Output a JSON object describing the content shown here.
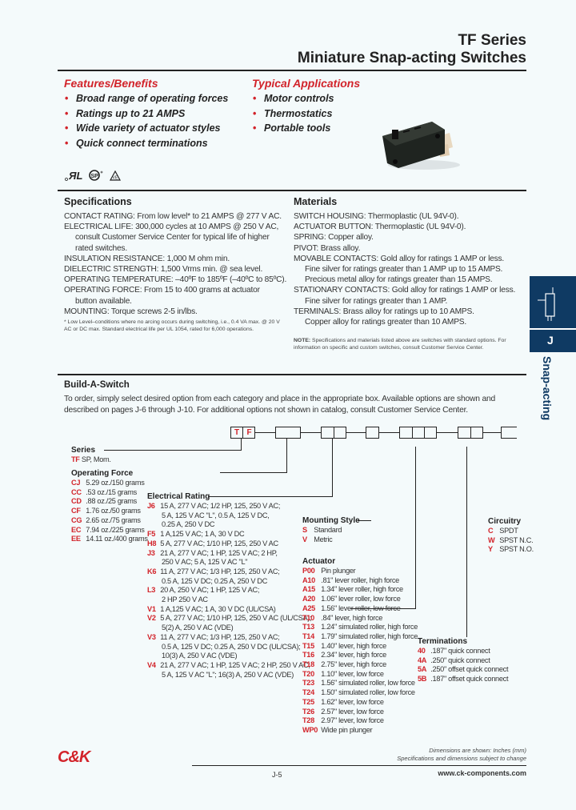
{
  "header": {
    "series": "TF Series",
    "title": "Miniature Snap-acting Switches"
  },
  "features": {
    "heading": "Features/Benefits",
    "items": [
      "Broad range of operating forces",
      "Ratings up to 21 AMPS",
      "Wide variety of actuator styles",
      "Quick connect terminations"
    ]
  },
  "applications": {
    "heading": "Typical Applications",
    "items": [
      "Motor controls",
      "Thermostatics",
      "Portable tools"
    ]
  },
  "certifications": [
    "UL-recognized-icon",
    "CSA-icon",
    "VDE-icon"
  ],
  "specifications": {
    "heading": "Specifications",
    "lines": [
      {
        "text": "CONTACT RATING: From low level* to 21 AMPS @ 277 V AC.",
        "indent": false
      },
      {
        "text": "ELECTRICAL LIFE: 300,000 cycles at 10 AMPS @ 250 V AC,",
        "indent": false
      },
      {
        "text": "consult Customer Service Center for typical life of higher",
        "indent": true
      },
      {
        "text": "rated switches.",
        "indent": true
      },
      {
        "text": "INSULATION RESISTANCE: 1,000 M ohm min.",
        "indent": false
      },
      {
        "text": "DIELECTRIC STRENGTH: 1,500 Vrms min. @ sea level.",
        "indent": false
      },
      {
        "text": "OPERATING TEMPERATURE: –40ºF to 185ºF (–40ºC to 85ºC).",
        "indent": false
      },
      {
        "text": "OPERATING FORCE: From 15 to 400 grams at actuator",
        "indent": false
      },
      {
        "text": "button available.",
        "indent": true
      },
      {
        "text": "MOUNTING: Torque screws 2-5 in/lbs.",
        "indent": false
      }
    ],
    "footnote": "* Low Level–conditions where no arcing occurs during switching, i.e., 0.4 VA max. @ 20 V AC or DC max. Standard electrical life per UL 1054, rated for 6,000 operations."
  },
  "materials": {
    "heading": "Materials",
    "lines": [
      {
        "text": "SWITCH HOUSING: Thermoplastic (UL 94V-0).",
        "indent": false
      },
      {
        "text": "ACTUATOR BUTTON: Thermoplastic (UL 94V-0).",
        "indent": false
      },
      {
        "text": "SPRING: Copper alloy.",
        "indent": false
      },
      {
        "text": "PIVOT: Brass alloy.",
        "indent": false
      },
      {
        "text": "MOVABLE CONTACTS: Gold alloy for ratings 1 AMP or less.",
        "indent": false
      },
      {
        "text": "Fine silver for ratings greater than 1 AMP up to 15 AMPS.",
        "indent": true
      },
      {
        "text": "Precious metal alloy for ratings greater than 15 AMPS.",
        "indent": true
      },
      {
        "text": "STATIONARY CONTACTS: Gold alloy for ratings 1 AMP or less.",
        "indent": false
      },
      {
        "text": "Fine silver for ratings greater than 1 AMP.",
        "indent": true
      },
      {
        "text": "TERMINALS: Brass alloy for ratings up to 10 AMPS.",
        "indent": false
      },
      {
        "text": "Copper alloy for ratings greater than 10 AMPS.",
        "indent": true
      }
    ],
    "note_label": "NOTE:",
    "note": "Specifications and materials listed above are switches with standard options. For information on specific and custom switches, consult Customer Service Center."
  },
  "sidebar": {
    "letter": "J",
    "label": "Snap-acting"
  },
  "build": {
    "heading": "Build-A-Switch",
    "intro": "To order, simply select desired option from each category and place in the appropriate box. Available options are shown and described on pages J-6 through J-10. For additional options not shown in catalog, consult Customer Service Center.",
    "prefix": [
      "T",
      "F"
    ],
    "series": {
      "heading": "Series",
      "options": [
        {
          "code": "TF",
          "desc": "SP, Mom."
        }
      ]
    },
    "operating_force": {
      "heading": "Operating Force",
      "options": [
        {
          "code": "CJ",
          "desc": "5.29 oz./150 grams"
        },
        {
          "code": "CC",
          "desc": ".53 oz./15 grams"
        },
        {
          "code": "CD",
          "desc": ".88 oz./25 grams"
        },
        {
          "code": "CF",
          "desc": "1.76 oz./50 grams"
        },
        {
          "code": "CG",
          "desc": "2.65 oz./75 grams"
        },
        {
          "code": "EC",
          "desc": "7.94 oz./225 grams"
        },
        {
          "code": "EE",
          "desc": "14.11 oz./400 grams"
        }
      ]
    },
    "electrical_rating": {
      "heading": "Electrical Rating",
      "options": [
        {
          "code": "J6",
          "lines": [
            "15 A, 277 V AC; 1/2 HP, 125, 250 V AC;",
            "5 A, 125 V AC \"L\", 0.5 A, 125 V DC,",
            "0.25 A, 250 V DC"
          ]
        },
        {
          "code": "F5",
          "lines": [
            "1 A,125 V AC; 1 A, 30 V DC"
          ]
        },
        {
          "code": "H8",
          "lines": [
            "5 A, 277 V AC; 1/10 HP, 125, 250 V AC"
          ]
        },
        {
          "code": "J3",
          "lines": [
            "21 A, 277 V AC; 1 HP, 125 V AC; 2 HP,",
            "250 V AC; 5 A, 125 V AC \"L\""
          ]
        },
        {
          "code": "K6",
          "lines": [
            "11 A, 277 V AC; 1/3 HP, 125, 250 V AC;",
            "0.5 A, 125 V DC; 0.25 A, 250 V DC"
          ]
        },
        {
          "code": "L3",
          "lines": [
            "20 A, 250 V AC; 1 HP, 125 V AC;",
            "2 HP 250 V AC"
          ]
        },
        {
          "code": "V1",
          "lines": [
            "1 A,125 V AC; 1 A, 30 V DC (UL/CSA)"
          ]
        },
        {
          "code": "V2",
          "lines": [
            "5 A, 277 V AC; 1/10 HP, 125, 250 V AC (UL/CSA);",
            "5(2) A, 250 V AC (VDE)"
          ]
        },
        {
          "code": "V3",
          "lines": [
            "11 A, 277 V AC; 1/3 HP, 125, 250 V AC;",
            "0.5 A, 125 V DC; 0.25 A, 250 V DC (UL/CSA);",
            "10(3) A, 250 V AC (VDE)"
          ]
        },
        {
          "code": "V4",
          "lines": [
            "21 A, 277 V AC; 1 HP, 125 V AC; 2 HP, 250 V AC;",
            "5 A, 125 V AC \"L\"; 16(3) A, 250 V AC (VDE)"
          ]
        }
      ]
    },
    "mounting_style": {
      "heading": "Mounting Style",
      "options": [
        {
          "code": "S",
          "desc": "Standard"
        },
        {
          "code": "V",
          "desc": "Metric"
        }
      ]
    },
    "actuator": {
      "heading": "Actuator",
      "options": [
        {
          "code": "P00",
          "desc": "Pin plunger"
        },
        {
          "code": "A10",
          "desc": ".81\" lever roller, high force"
        },
        {
          "code": "A15",
          "desc": "1.34\" lever roller, high force"
        },
        {
          "code": "A20",
          "desc": "1.06\" lever roller, low force"
        },
        {
          "code": "A25",
          "desc": "1.56\" lever roller, low force"
        },
        {
          "code": "T10",
          "desc": ".84\" lever, high force"
        },
        {
          "code": "T13",
          "desc": "1.24\" simulated roller, high force"
        },
        {
          "code": "T14",
          "desc": "1.79\" simulated roller, high force"
        },
        {
          "code": "T15",
          "desc": "1.40\" lever, high force"
        },
        {
          "code": "T16",
          "desc": "2.34\" lever, high force"
        },
        {
          "code": "T18",
          "desc": "2.75\" lever, high force"
        },
        {
          "code": "T20",
          "desc": "1.10\" lever, low force"
        },
        {
          "code": "T23",
          "desc": "1.56\" simulated roller, low force"
        },
        {
          "code": "T24",
          "desc": "1.50\" simulated roller, low force"
        },
        {
          "code": "T25",
          "desc": "1.62\" lever, low force"
        },
        {
          "code": "T26",
          "desc": "2.57\" lever, low force"
        },
        {
          "code": "T28",
          "desc": "2.97\" lever, low force"
        },
        {
          "code": "WP0",
          "desc": "Wide pin plunger"
        }
      ]
    },
    "circuitry": {
      "heading": "Circuitry",
      "options": [
        {
          "code": "C",
          "desc": "SPDT"
        },
        {
          "code": "W",
          "desc": "SPST N.C."
        },
        {
          "code": "Y",
          "desc": "SPST N.O."
        }
      ]
    },
    "terminations": {
      "heading": "Terminations",
      "options": [
        {
          "code": "40",
          "desc": ".187\" quick connect"
        },
        {
          "code": "4A",
          "desc": ".250\" quick connect"
        },
        {
          "code": "5A",
          "desc": ".250\" offset quick connect"
        },
        {
          "code": "5B",
          "desc": ".187\" offset quick connect"
        }
      ]
    }
  },
  "footer": {
    "logo": "C&K",
    "note1": "Dimensions are shown: Inches (mm)",
    "note2": "Specifications and dimensions subject to change",
    "page": "J-5",
    "url": "www.ck-components.com"
  },
  "colors": {
    "accent_red": "#d2232a",
    "navy": "#0f3a63",
    "background": "#f4fafb"
  }
}
